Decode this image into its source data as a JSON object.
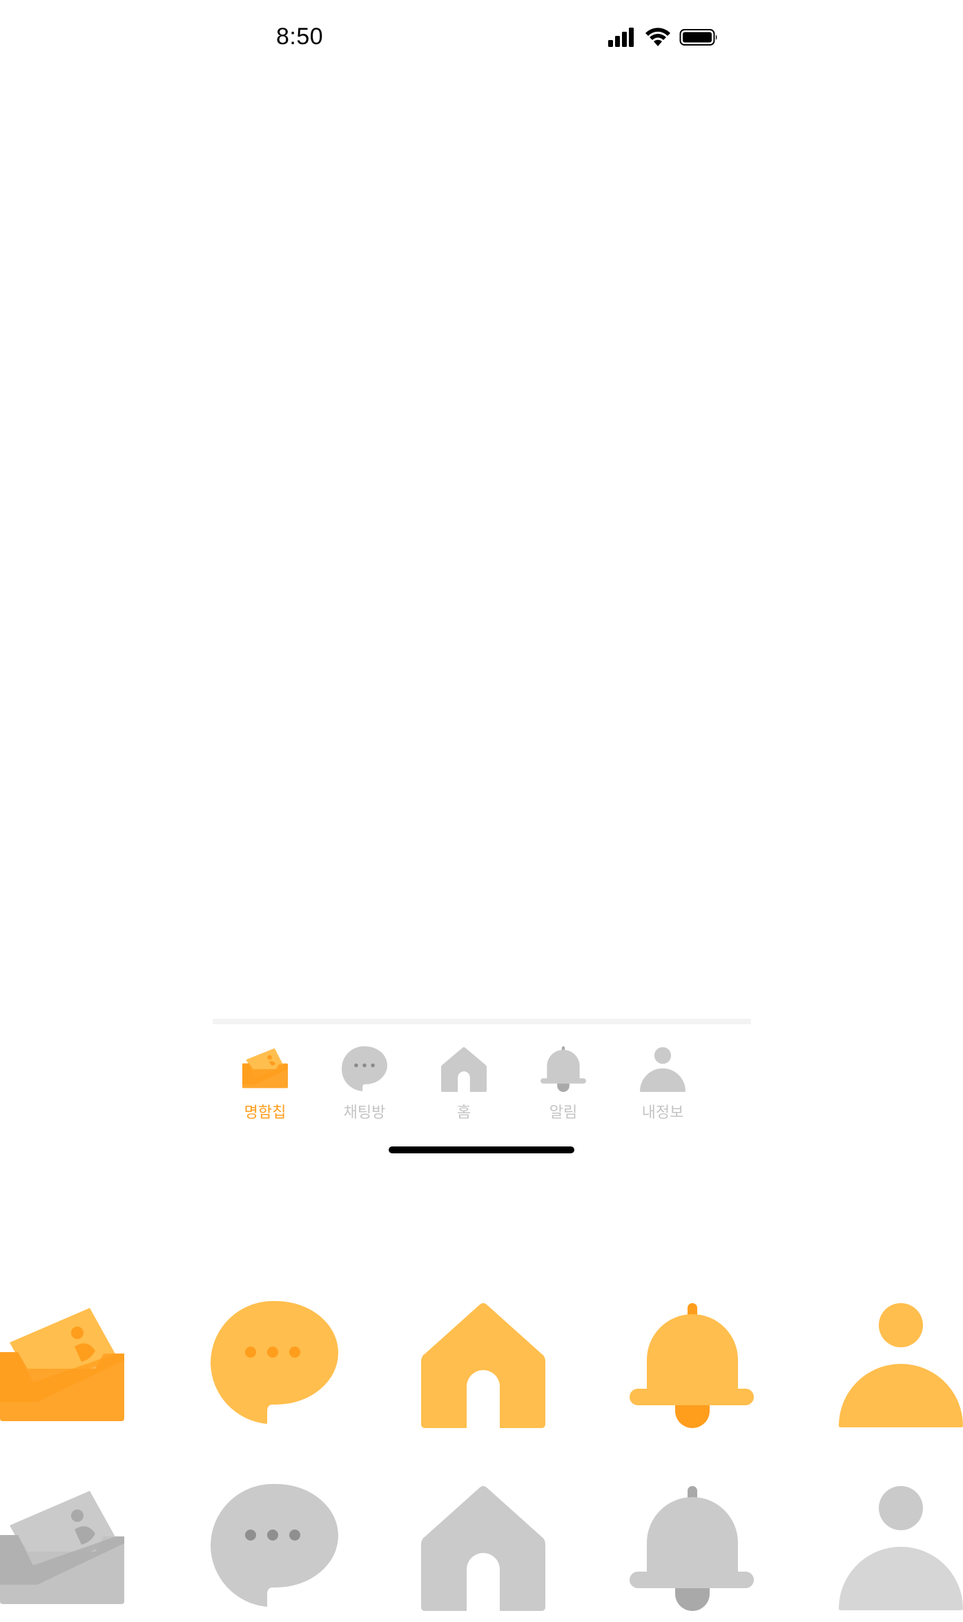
{
  "status_bar": {
    "time": "8:50"
  },
  "tab_bar": {
    "items": [
      {
        "label": "명함칩",
        "icon": "card-envelope-icon",
        "active": true
      },
      {
        "label": "채팅방",
        "icon": "chat-bubble-icon",
        "active": false
      },
      {
        "label": "홈",
        "icon": "home-icon",
        "active": false
      },
      {
        "label": "알림",
        "icon": "bell-icon",
        "active": false
      },
      {
        "label": "내정보",
        "icon": "person-icon",
        "active": false
      }
    ]
  },
  "icon_sheet": {
    "active_row": [
      "card-envelope-icon",
      "chat-bubble-icon",
      "home-icon",
      "bell-icon",
      "person-icon"
    ],
    "inactive_row": [
      "card-envelope-icon",
      "chat-bubble-icon",
      "home-icon",
      "bell-icon",
      "person-icon"
    ]
  },
  "colors": {
    "accent": "#ff9d1d",
    "accent_light": "#ffbe4d",
    "inactive": "#cacaca",
    "inactive_dark": "#a9a9a9",
    "tab_label_inactive": "#c4c4c4"
  }
}
